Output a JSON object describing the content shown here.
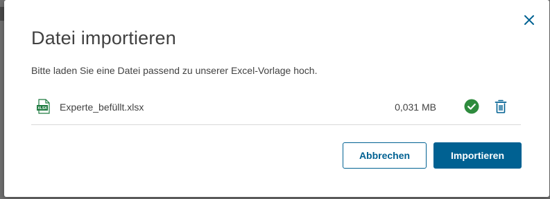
{
  "dialog": {
    "title": "Datei importieren",
    "subtitle": "Bitte laden Sie eine Datei passend zu unserer Excel-Vorlage hoch.",
    "close_icon": "close-icon"
  },
  "file": {
    "icon": "xlsx-file-icon",
    "icon_label": "XLSX",
    "name": "Experte_befüllt.xlsx",
    "size": "0,031 MB",
    "status_icon": "check-circle-icon",
    "status": "success",
    "delete_icon": "trash-icon"
  },
  "actions": {
    "cancel_label": "Abbrechen",
    "import_label": "Importieren"
  },
  "colors": {
    "primary": "#006192",
    "success": "#2e8b3d",
    "excel_green": "#1d7a3f",
    "text": "#414141",
    "divider": "#d9d9d9"
  }
}
